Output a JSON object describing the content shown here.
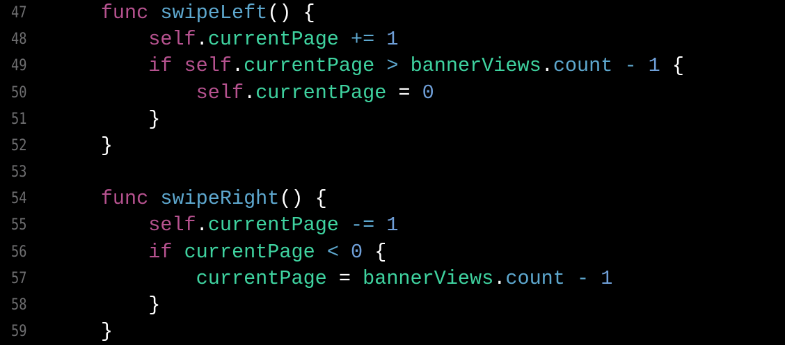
{
  "colors": {
    "background": "#000000",
    "keyword": "#b6528f",
    "function": "#5ea8cf",
    "property": "#3fd3a0",
    "number": "#6f9fd8",
    "operator": "#5ea8cf",
    "plain": "#ffffff",
    "line_number": "#6e6e70"
  },
  "lines": [
    {
      "number": "47",
      "tokens": [
        {
          "t": "        ",
          "c": "plain"
        },
        {
          "t": "func",
          "c": "kw"
        },
        {
          "t": " ",
          "c": "plain"
        },
        {
          "t": "swipeLeft",
          "c": "fn"
        },
        {
          "t": "() {",
          "c": "plain"
        }
      ]
    },
    {
      "number": "48",
      "tokens": [
        {
          "t": "            ",
          "c": "plain"
        },
        {
          "t": "self",
          "c": "kw"
        },
        {
          "t": ".",
          "c": "plain"
        },
        {
          "t": "currentPage",
          "c": "prop"
        },
        {
          "t": " ",
          "c": "plain"
        },
        {
          "t": "+=",
          "c": "op"
        },
        {
          "t": " ",
          "c": "plain"
        },
        {
          "t": "1",
          "c": "num"
        }
      ]
    },
    {
      "number": "49",
      "tokens": [
        {
          "t": "            ",
          "c": "plain"
        },
        {
          "t": "if",
          "c": "kw"
        },
        {
          "t": " ",
          "c": "plain"
        },
        {
          "t": "self",
          "c": "kw"
        },
        {
          "t": ".",
          "c": "plain"
        },
        {
          "t": "currentPage",
          "c": "prop"
        },
        {
          "t": " ",
          "c": "plain"
        },
        {
          "t": ">",
          "c": "op"
        },
        {
          "t": " ",
          "c": "plain"
        },
        {
          "t": "bannerViews",
          "c": "prop"
        },
        {
          "t": ".",
          "c": "plain"
        },
        {
          "t": "count",
          "c": "fn"
        },
        {
          "t": " ",
          "c": "plain"
        },
        {
          "t": "-",
          "c": "op"
        },
        {
          "t": " ",
          "c": "plain"
        },
        {
          "t": "1",
          "c": "num"
        },
        {
          "t": " {",
          "c": "plain"
        }
      ]
    },
    {
      "number": "50",
      "tokens": [
        {
          "t": "                ",
          "c": "plain"
        },
        {
          "t": "self",
          "c": "kw"
        },
        {
          "t": ".",
          "c": "plain"
        },
        {
          "t": "currentPage",
          "c": "prop"
        },
        {
          "t": " = ",
          "c": "plain"
        },
        {
          "t": "0",
          "c": "num"
        }
      ]
    },
    {
      "number": "51",
      "tokens": [
        {
          "t": "            }",
          "c": "plain"
        }
      ]
    },
    {
      "number": "52",
      "tokens": [
        {
          "t": "        }",
          "c": "plain"
        }
      ]
    },
    {
      "number": "53",
      "tokens": []
    },
    {
      "number": "54",
      "tokens": [
        {
          "t": "        ",
          "c": "plain"
        },
        {
          "t": "func",
          "c": "kw"
        },
        {
          "t": " ",
          "c": "plain"
        },
        {
          "t": "swipeRight",
          "c": "fn"
        },
        {
          "t": "() {",
          "c": "plain"
        }
      ]
    },
    {
      "number": "55",
      "tokens": [
        {
          "t": "            ",
          "c": "plain"
        },
        {
          "t": "self",
          "c": "kw"
        },
        {
          "t": ".",
          "c": "plain"
        },
        {
          "t": "currentPage",
          "c": "prop"
        },
        {
          "t": " ",
          "c": "plain"
        },
        {
          "t": "-=",
          "c": "op"
        },
        {
          "t": " ",
          "c": "plain"
        },
        {
          "t": "1",
          "c": "num"
        }
      ]
    },
    {
      "number": "56",
      "tokens": [
        {
          "t": "            ",
          "c": "plain"
        },
        {
          "t": "if",
          "c": "kw"
        },
        {
          "t": " ",
          "c": "plain"
        },
        {
          "t": "currentPage",
          "c": "prop"
        },
        {
          "t": " ",
          "c": "plain"
        },
        {
          "t": "<",
          "c": "op"
        },
        {
          "t": " ",
          "c": "plain"
        },
        {
          "t": "0",
          "c": "num"
        },
        {
          "t": " {",
          "c": "plain"
        }
      ]
    },
    {
      "number": "57",
      "tokens": [
        {
          "t": "                ",
          "c": "plain"
        },
        {
          "t": "currentPage",
          "c": "prop"
        },
        {
          "t": " = ",
          "c": "plain"
        },
        {
          "t": "bannerViews",
          "c": "prop"
        },
        {
          "t": ".",
          "c": "plain"
        },
        {
          "t": "count",
          "c": "fn"
        },
        {
          "t": " ",
          "c": "plain"
        },
        {
          "t": "-",
          "c": "op"
        },
        {
          "t": " ",
          "c": "plain"
        },
        {
          "t": "1",
          "c": "num"
        }
      ]
    },
    {
      "number": "58",
      "tokens": [
        {
          "t": "            }",
          "c": "plain"
        }
      ]
    },
    {
      "number": "59",
      "tokens": [
        {
          "t": "        }",
          "c": "plain"
        }
      ]
    }
  ]
}
